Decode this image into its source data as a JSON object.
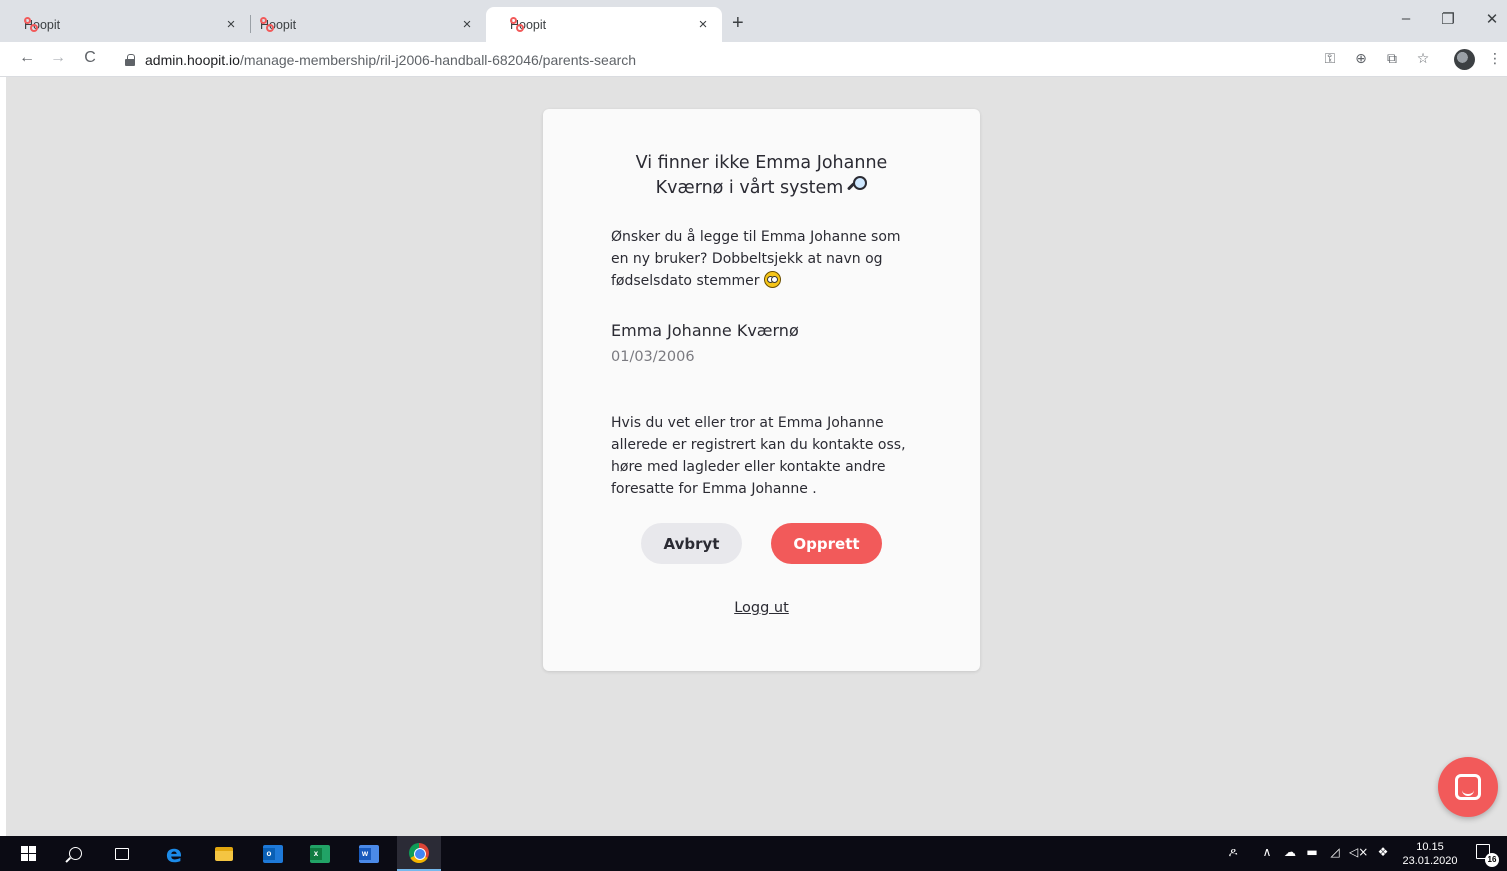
{
  "browser": {
    "tabs": [
      {
        "title": "Hoopit",
        "active": false
      },
      {
        "title": "Hoopit",
        "active": false
      },
      {
        "title": "Hoopit",
        "active": true
      }
    ],
    "tab_close_glyph": "×",
    "new_tab_glyph": "+",
    "window_controls": {
      "minimize": "–",
      "maximize": "❐",
      "close": "✕"
    },
    "nav": {
      "back": "←",
      "forward": "→",
      "reload": "C"
    },
    "url_host": "admin.hoopit.io",
    "url_path": "/manage-membership/ril-j2006-handball-682046/parents-search",
    "toolbar_icons": {
      "key": "⚿",
      "plus": "⊕",
      "translate": "⧉",
      "star": "☆",
      "menu": "⋮"
    }
  },
  "page": {
    "background_color": "#e2e2e2",
    "accent_color": "#f25a5a",
    "card": {
      "title_line1": "Vi finner ikke Emma Johanne",
      "title_line2": "Kværnø i vårt system",
      "question": "Ønsker du å legge til Emma Johanne som en ny bruker? Dobbeltsjekk at navn og fødselsdato stemmer",
      "person_name": "Emma Johanne Kværnø",
      "person_dob": "01/03/2006",
      "info": "Hvis du vet eller tror at Emma Johanne allerede er registrert kan du kontakte oss, høre med lagleder eller kontakte andre foresatte for Emma Johanne .",
      "cancel_label": "Avbryt",
      "create_label": "Opprett",
      "logout_label": "Logg ut"
    }
  },
  "taskbar": {
    "apps": [
      "windows-start",
      "search",
      "task-view",
      "edge",
      "file-explorer",
      "outlook",
      "excel",
      "word",
      "chrome"
    ],
    "office_letters": {
      "outlook": "o",
      "excel": "x",
      "word": "w"
    },
    "tray": {
      "people": "ዶ",
      "chevron": "∧",
      "cloud": "☁",
      "battery": "▬",
      "wifi": "◿",
      "volume": "◁×",
      "dropbox": "❖"
    },
    "clock_time": "10.15",
    "clock_date": "23.01.2020",
    "notification_count": "16"
  }
}
